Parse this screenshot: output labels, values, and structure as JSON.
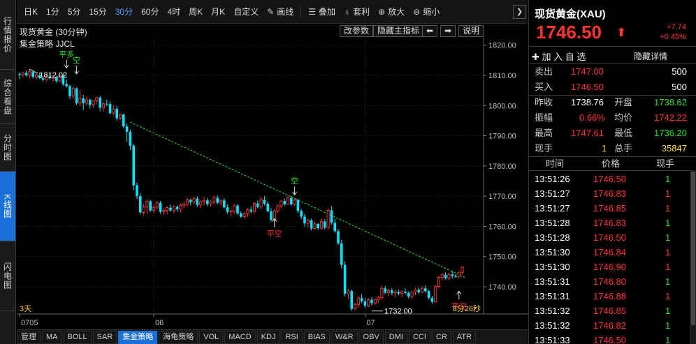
{
  "left_tabs": [
    {
      "label": "行情报价",
      "active": false
    },
    {
      "label": "综合看盘",
      "active": false
    },
    {
      "label": "分时图",
      "active": false
    },
    {
      "label": "K线图",
      "active": true
    },
    {
      "label": "闪电图",
      "active": false
    }
  ],
  "toolbar": {
    "periods": [
      {
        "label": "日K",
        "active": false
      },
      {
        "label": "1分",
        "active": false
      },
      {
        "label": "5分",
        "active": false
      },
      {
        "label": "15分",
        "active": false
      },
      {
        "label": "30分",
        "active": true
      },
      {
        "label": "60分",
        "active": false
      },
      {
        "label": "4时",
        "active": false
      },
      {
        "label": "周K",
        "active": false
      },
      {
        "label": "月K",
        "active": false
      },
      {
        "label": "自定义",
        "active": false
      }
    ],
    "draw_label": "画线",
    "overlay_label": "叠加",
    "arbitrage_label": "套利",
    "zoom_in_label": "放大",
    "zoom_out_label": "缩小",
    "collapse_glyph": "❯"
  },
  "chart_header": {
    "title": "现货黄金 (30分钟)",
    "params_label": "改参数",
    "hide_indicator_label": "隐藏主指标",
    "left_arrow": "⬅",
    "right_arrow": "➡",
    "help_label": "说明",
    "indicator_name": "集金策略 JJCL"
  },
  "chart_data": {
    "type": "candlestick",
    "title": "现货黄金 (30分钟)",
    "y_ticks": [
      "1820.00",
      "1810.00",
      "1800.00",
      "1790.00",
      "1780.00",
      "1770.00",
      "1760.00",
      "1750.00",
      "1740.00"
    ],
    "ylim": [
      1731,
      1822
    ],
    "x_ticks": [
      {
        "label": "0705",
        "index": 0
      },
      {
        "label": "06",
        "index": 40
      },
      {
        "label": "07",
        "index": 103
      }
    ],
    "bottom_left_label": "3天",
    "bottom_right_label": "8分26秒",
    "grid": true,
    "high_annotation": {
      "label": "1812.02",
      "index": 3,
      "value": 1812.02
    },
    "low_annotation": {
      "label": "1732.00",
      "index": 105,
      "value": 1732.0
    },
    "signals": [
      {
        "label": "平多",
        "index": 14,
        "value": 1812,
        "color": "#22e022",
        "position": "above"
      },
      {
        "label": "空",
        "index": 17,
        "value": 1810,
        "color": "#22e022",
        "position": "above"
      },
      {
        "label": "空",
        "index": 82,
        "value": 1770,
        "color": "#22e022",
        "position": "above"
      },
      {
        "label": "平空",
        "index": 76,
        "value": 1763,
        "color": "#ff3333",
        "position": "below"
      },
      {
        "label": "平空",
        "index": 131,
        "value": 1739,
        "color": "#ff3333",
        "position": "below"
      }
    ],
    "trendline": [
      {
        "index": 33,
        "value": 1794.5
      },
      {
        "index": 133,
        "value": 1743
      }
    ],
    "candles_ohlc": [
      [
        1810.5,
        1811.0,
        1808.8,
        1810.2
      ],
      [
        1810.2,
        1811.2,
        1809.5,
        1810.8
      ],
      [
        1810.8,
        1811.6,
        1809.6,
        1810.0
      ],
      [
        1810.0,
        1812.0,
        1809.0,
        1811.2
      ],
      [
        1811.2,
        1811.5,
        1808.9,
        1809.5
      ],
      [
        1809.5,
        1810.8,
        1808.5,
        1810.1
      ],
      [
        1810.1,
        1811.0,
        1808.8,
        1809.0
      ],
      [
        1809.0,
        1809.8,
        1808.0,
        1808.5
      ],
      [
        1808.5,
        1810.2,
        1808.0,
        1809.6
      ],
      [
        1809.6,
        1810.5,
        1808.5,
        1809.0
      ],
      [
        1809.0,
        1810.0,
        1807.9,
        1809.3
      ],
      [
        1809.3,
        1809.9,
        1807.5,
        1808.1
      ],
      [
        1808.1,
        1810.3,
        1807.8,
        1810.0
      ],
      [
        1810.0,
        1810.6,
        1806.5,
        1807.1
      ],
      [
        1807.1,
        1808.6,
        1806.0,
        1806.4
      ],
      [
        1806.4,
        1806.9,
        1802.1,
        1803.1
      ],
      [
        1803.1,
        1806.2,
        1802.0,
        1805.7
      ],
      [
        1805.7,
        1806.0,
        1800.2,
        1800.8
      ],
      [
        1800.8,
        1804.9,
        1799.8,
        1802.4
      ],
      [
        1802.4,
        1803.5,
        1798.5,
        1800.8
      ],
      [
        1800.8,
        1803.1,
        1800.2,
        1801.9
      ],
      [
        1801.9,
        1802.3,
        1799.0,
        1800.2
      ],
      [
        1800.2,
        1801.8,
        1799.3,
        1801.6
      ],
      [
        1801.6,
        1802.9,
        1800.6,
        1802.6
      ],
      [
        1802.6,
        1803.2,
        1798.1,
        1799.3
      ],
      [
        1799.3,
        1801.1,
        1797.9,
        1800.6
      ],
      [
        1800.6,
        1802.0,
        1799.8,
        1800.5
      ],
      [
        1800.5,
        1801.5,
        1797.0,
        1797.5
      ],
      [
        1797.5,
        1800.2,
        1796.8,
        1798.9
      ],
      [
        1798.9,
        1799.9,
        1795.0,
        1795.8
      ],
      [
        1795.8,
        1797.6,
        1795.2,
        1797.0
      ],
      [
        1797.0,
        1797.4,
        1792.5,
        1793.1
      ],
      [
        1793.1,
        1794.0,
        1788.0,
        1791.3
      ],
      [
        1791.3,
        1792.0,
        1785.3,
        1786.7
      ],
      [
        1786.7,
        1787.4,
        1772.0,
        1773.6
      ],
      [
        1773.6,
        1774.6,
        1769.0,
        1770.0
      ],
      [
        1770.0,
        1771.0,
        1764.0,
        1764.6
      ],
      [
        1764.6,
        1767.6,
        1763.7,
        1766.4
      ],
      [
        1766.4,
        1769.0,
        1764.1,
        1768.3
      ],
      [
        1768.3,
        1768.8,
        1764.7,
        1765.3
      ],
      [
        1765.3,
        1767.1,
        1764.3,
        1766.3
      ],
      [
        1766.3,
        1768.4,
        1765.6,
        1767.8
      ],
      [
        1767.8,
        1768.4,
        1764.2,
        1764.8
      ],
      [
        1764.8,
        1766.1,
        1763.8,
        1765.3
      ],
      [
        1765.3,
        1766.7,
        1764.1,
        1766.2
      ],
      [
        1766.2,
        1767.3,
        1764.8,
        1765.3
      ],
      [
        1765.3,
        1767.1,
        1764.3,
        1766.5
      ],
      [
        1766.5,
        1767.0,
        1764.9,
        1765.7
      ],
      [
        1765.7,
        1767.6,
        1764.5,
        1767.0
      ],
      [
        1767.0,
        1768.2,
        1766.0,
        1767.4
      ],
      [
        1767.4,
        1769.5,
        1766.4,
        1768.8
      ],
      [
        1768.8,
        1769.2,
        1766.9,
        1768.0
      ],
      [
        1768.0,
        1769.9,
        1767.2,
        1769.2
      ],
      [
        1769.2,
        1770.0,
        1766.5,
        1767.1
      ],
      [
        1767.1,
        1768.6,
        1766.0,
        1768.2
      ],
      [
        1768.2,
        1769.7,
        1767.1,
        1768.6
      ],
      [
        1768.6,
        1769.4,
        1766.7,
        1767.4
      ],
      [
        1767.4,
        1768.8,
        1766.5,
        1768.1
      ],
      [
        1768.1,
        1770.2,
        1767.4,
        1769.5
      ],
      [
        1769.5,
        1770.3,
        1767.3,
        1767.8
      ],
      [
        1767.8,
        1769.0,
        1766.9,
        1768.6
      ],
      [
        1768.6,
        1769.3,
        1765.9,
        1766.3
      ],
      [
        1766.3,
        1767.3,
        1764.2,
        1764.8
      ],
      [
        1764.8,
        1765.7,
        1763.4,
        1765.0
      ],
      [
        1765.0,
        1767.4,
        1764.2,
        1766.9
      ],
      [
        1766.9,
        1767.4,
        1763.8,
        1764.3
      ],
      [
        1764.3,
        1765.0,
        1762.8,
        1763.2
      ],
      [
        1763.2,
        1764.6,
        1762.6,
        1764.2
      ],
      [
        1764.2,
        1766.1,
        1763.1,
        1765.5
      ],
      [
        1765.5,
        1766.6,
        1764.3,
        1764.9
      ],
      [
        1764.9,
        1768.0,
        1764.1,
        1767.6
      ],
      [
        1767.6,
        1768.6,
        1765.9,
        1766.4
      ],
      [
        1766.4,
        1769.7,
        1765.6,
        1768.8
      ],
      [
        1768.8,
        1770.0,
        1767.0,
        1767.5
      ],
      [
        1767.5,
        1768.3,
        1764.6,
        1765.0
      ],
      [
        1765.0,
        1766.0,
        1761.6,
        1762.1
      ],
      [
        1762.1,
        1765.7,
        1761.5,
        1765.1
      ],
      [
        1765.1,
        1767.3,
        1764.4,
        1766.8
      ],
      [
        1766.8,
        1768.8,
        1766.0,
        1768.4
      ],
      [
        1768.4,
        1769.2,
        1766.7,
        1767.3
      ],
      [
        1767.3,
        1770.1,
        1767.2,
        1769.4
      ],
      [
        1769.4,
        1770.0,
        1766.8,
        1767.3
      ],
      [
        1767.3,
        1769.3,
        1766.7,
        1768.8
      ],
      [
        1768.8,
        1769.0,
        1764.4,
        1765.1
      ],
      [
        1765.1,
        1765.7,
        1762.4,
        1763.2
      ],
      [
        1763.2,
        1764.1,
        1759.9,
        1761.0
      ],
      [
        1761.0,
        1762.6,
        1759.5,
        1762.0
      ],
      [
        1762.0,
        1762.6,
        1758.7,
        1759.3
      ],
      [
        1759.3,
        1761.6,
        1758.8,
        1760.8
      ],
      [
        1760.8,
        1761.2,
        1758.8,
        1759.4
      ],
      [
        1759.4,
        1762.5,
        1758.7,
        1761.6
      ],
      [
        1761.6,
        1762.4,
        1759.0,
        1759.6
      ],
      [
        1759.6,
        1765.9,
        1758.9,
        1765.3
      ],
      [
        1765.3,
        1766.8,
        1760.6,
        1761.2
      ],
      [
        1761.2,
        1762.5,
        1757.9,
        1758.4
      ],
      [
        1758.4,
        1759.2,
        1753.8,
        1754.4
      ],
      [
        1754.4,
        1755.6,
        1746.1,
        1747.3
      ],
      [
        1747.3,
        1748.4,
        1736.8,
        1737.7
      ],
      [
        1737.7,
        1739.3,
        1735.9,
        1738.6
      ],
      [
        1738.6,
        1739.1,
        1732.0,
        1732.7
      ],
      [
        1732.7,
        1734.7,
        1732.3,
        1734.1
      ],
      [
        1734.1,
        1736.9,
        1733.1,
        1736.3
      ],
      [
        1736.3,
        1737.6,
        1734.6,
        1735.2
      ],
      [
        1735.2,
        1736.2,
        1733.0,
        1733.7
      ],
      [
        1733.7,
        1736.3,
        1733.2,
        1735.7
      ],
      [
        1735.7,
        1736.6,
        1733.8,
        1734.6
      ],
      [
        1734.6,
        1736.1,
        1734.0,
        1735.8
      ],
      [
        1735.8,
        1737.1,
        1734.6,
        1736.4
      ],
      [
        1736.4,
        1740.2,
        1735.8,
        1739.5
      ],
      [
        1739.5,
        1740.3,
        1737.6,
        1738.1
      ],
      [
        1738.1,
        1739.4,
        1736.8,
        1738.8
      ],
      [
        1738.8,
        1739.5,
        1737.2,
        1737.9
      ],
      [
        1737.9,
        1739.0,
        1736.6,
        1738.3
      ],
      [
        1738.3,
        1739.1,
        1737.2,
        1737.8
      ],
      [
        1737.8,
        1738.9,
        1736.5,
        1738.4
      ],
      [
        1738.4,
        1739.5,
        1737.4,
        1738.0
      ],
      [
        1738.0,
        1738.5,
        1736.1,
        1736.8
      ],
      [
        1736.8,
        1738.7,
        1736.0,
        1738.3
      ],
      [
        1738.3,
        1739.6,
        1737.2,
        1739.0
      ],
      [
        1739.0,
        1739.8,
        1737.6,
        1738.2
      ],
      [
        1738.2,
        1740.2,
        1737.8,
        1739.5
      ],
      [
        1739.5,
        1740.5,
        1738.0,
        1738.6
      ],
      [
        1738.6,
        1739.0,
        1735.8,
        1736.3
      ],
      [
        1736.3,
        1737.0,
        1734.4,
        1735.0
      ],
      [
        1735.0,
        1740.6,
        1734.7,
        1740.1
      ],
      [
        1740.1,
        1743.6,
        1739.5,
        1743.1
      ],
      [
        1743.1,
        1744.6,
        1742.1,
        1744.0
      ],
      [
        1744.0,
        1744.9,
        1742.3,
        1742.8
      ],
      [
        1742.8,
        1744.7,
        1742.2,
        1744.1
      ],
      [
        1744.1,
        1745.4,
        1742.7,
        1743.6
      ],
      [
        1743.6,
        1744.3,
        1743.0,
        1743.3
      ],
      [
        1743.3,
        1745.0,
        1743.0,
        1744.8
      ],
      [
        1744.8,
        1746.8,
        1744.2,
        1746.5
      ]
    ]
  },
  "quote": {
    "name": "现货黄金(XAU)",
    "price": "1746.50",
    "arrow": "⬆",
    "change": "+7.74",
    "change_pct": "+0.45%",
    "add_watch": "✚ 加 入 自 选",
    "hide_detail": "隐藏详情",
    "sell_label": "卖出",
    "sell_price": "1747.00",
    "sell_qty": "500",
    "buy_label": "买入",
    "buy_price": "1746.50",
    "buy_qty": "500",
    "prev_close_label": "昨收",
    "prev_close": "1738.76",
    "open_label": "开盘",
    "open": "1738.62",
    "amplitude_label": "振幅",
    "amplitude": "0.66%",
    "avg_label": "均价",
    "avg": "1742.22",
    "high_label": "最高",
    "high": "1747.61",
    "low_label": "最低",
    "low": "1736.20",
    "current_vol_label": "现手",
    "current_vol": "1",
    "total_vol_label": "总手",
    "total_vol": "35847"
  },
  "ticks": {
    "headers": [
      "时间",
      "价格",
      "现手"
    ],
    "rows": [
      {
        "time": "13:51:26",
        "price": "1746.50",
        "vol": "1",
        "dir": "up"
      },
      {
        "time": "13:51:27",
        "price": "1746.83",
        "vol": "1",
        "dir": "down"
      },
      {
        "time": "13:51:27",
        "price": "1746.85",
        "vol": "1",
        "dir": "down"
      },
      {
        "time": "13:51:28",
        "price": "1746.83",
        "vol": "1",
        "dir": "up"
      },
      {
        "time": "13:51:28",
        "price": "1746.50",
        "vol": "1",
        "dir": "up"
      },
      {
        "time": "13:51:30",
        "price": "1746.84",
        "vol": "1",
        "dir": "down"
      },
      {
        "time": "13:51:30",
        "price": "1746.90",
        "vol": "1",
        "dir": "down"
      },
      {
        "time": "13:51:31",
        "price": "1746.80",
        "vol": "1",
        "dir": "up"
      },
      {
        "time": "13:51:31",
        "price": "1746.88",
        "vol": "1",
        "dir": "down"
      },
      {
        "time": "13:51:32",
        "price": "1746.85",
        "vol": "1",
        "dir": "up"
      },
      {
        "time": "13:51:32",
        "price": "1746.82",
        "vol": "1",
        "dir": "up"
      },
      {
        "time": "13:51:33",
        "price": "1746.50",
        "vol": "1",
        "dir": "up"
      }
    ]
  },
  "indicator_bar": [
    {
      "label": "管理",
      "active": false
    },
    {
      "label": "MA",
      "active": false
    },
    {
      "label": "BOLL",
      "active": false
    },
    {
      "label": "SAR",
      "active": false
    },
    {
      "label": "集金策略",
      "active": true
    },
    {
      "label": "海龟策略",
      "active": false
    },
    {
      "label": "VOL",
      "active": false
    },
    {
      "label": "MACD",
      "active": false
    },
    {
      "label": "KDJ",
      "active": false
    },
    {
      "label": "RSI",
      "active": false
    },
    {
      "label": "BIAS",
      "active": false
    },
    {
      "label": "W&R",
      "active": false
    },
    {
      "label": "OBV",
      "active": false
    },
    {
      "label": "DMI",
      "active": false
    },
    {
      "label": "CCI",
      "active": false
    },
    {
      "label": "CR",
      "active": false
    },
    {
      "label": "ATR",
      "active": false
    }
  ],
  "colors": {
    "up": "#ff3333",
    "down": "#00e5ff",
    "trend": "#33dd33",
    "grid": "#2a2a2a",
    "tick_up": "#ff3333",
    "tick_down": "#22e022"
  }
}
